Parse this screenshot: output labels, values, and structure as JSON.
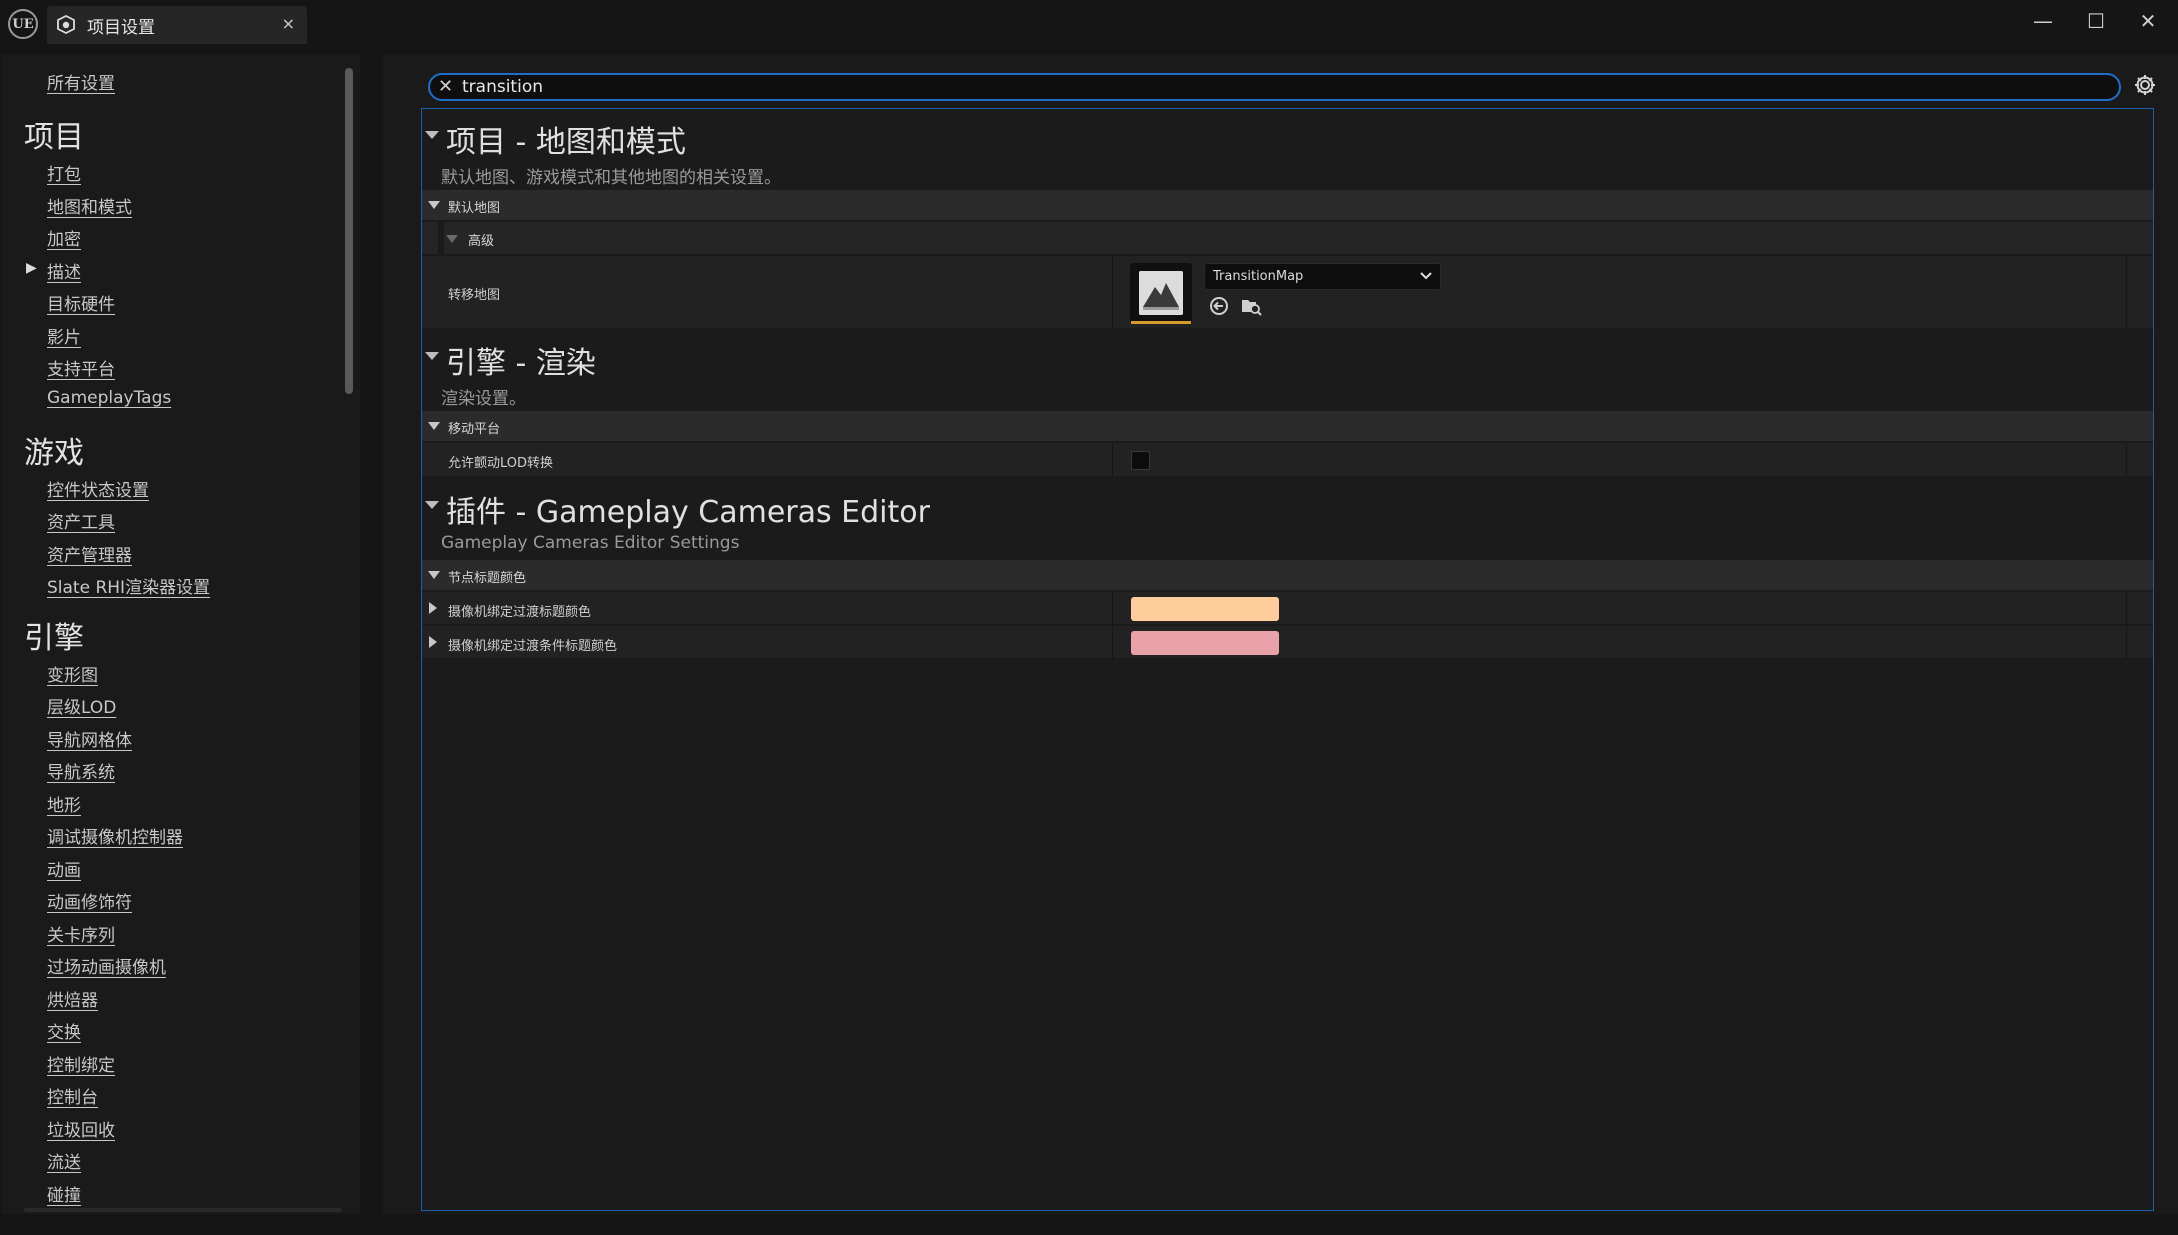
{
  "window": {
    "logo_text": "UE",
    "tab_title": "项目设置",
    "tab_close": "×",
    "min_glyph": "—",
    "max_glyph": "☐",
    "close_glyph": "✕"
  },
  "sidebar": {
    "all_settings": "所有设置",
    "groups": [
      {
        "heading": "项目",
        "items": [
          "打包",
          "地图和模式",
          "加密",
          "描述",
          "目标硬件",
          "影片",
          "支持平台",
          "GameplayTags"
        ]
      },
      {
        "heading": "游戏",
        "items": [
          "控件状态设置",
          "资产工具",
          "资产管理器",
          "Slate RHI渲染器设置"
        ]
      },
      {
        "heading": "引擎",
        "items": [
          "变形图",
          "层级LOD",
          "导航网格体",
          "导航系统",
          "地形",
          "调试摄像机控制器",
          "动画",
          "动画修饰符",
          "关卡序列",
          "过场动画摄像机",
          "烘焙器",
          "交换",
          "控制绑定",
          "控制台",
          "垃圾回收",
          "流送",
          "碰撞"
        ]
      }
    ]
  },
  "search": {
    "value": "transition",
    "clear_icon": "close-icon"
  },
  "sections": [
    {
      "title": "项目 - 地图和模式",
      "description": "默认地图、游戏模式和其他地图的相关设置。",
      "category": "默认地图",
      "subcategory": "高级",
      "property": {
        "label": "转移地图",
        "value": "TransitionMap"
      }
    },
    {
      "title": "引擎 - 渲染",
      "description": "渲染设置。",
      "category": "移动平台",
      "property": {
        "label": "允许颤动LOD转换",
        "checked": false
      }
    },
    {
      "title": "插件 - Gameplay Cameras Editor",
      "description": "Gameplay Cameras Editor Settings",
      "category": "节点标题颜色",
      "properties": [
        {
          "label": "摄像机绑定过渡标题颜色",
          "color": "#ffcc9c"
        },
        {
          "label": "摄像机绑定过渡条件标题颜色",
          "color": "#e8a2a8"
        }
      ]
    }
  ],
  "colors": {
    "accent_blue": "#1f6fc9",
    "thumb_underline": "#d69a2d",
    "background": "#1a1a1a"
  }
}
